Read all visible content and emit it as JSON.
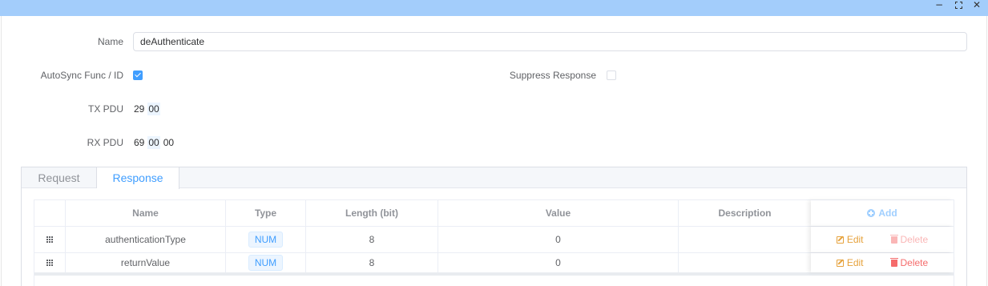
{
  "window": {
    "minimize": "−",
    "close": "✕",
    "maximize_icon": "maximize-icon"
  },
  "form": {
    "name_label": "Name",
    "name_value": "deAuthenticate",
    "autosync_label": "AutoSync Func / ID",
    "autosync_checked": true,
    "suppress_label": "Suppress Response",
    "suppress_checked": false,
    "tx_label": "TX PDU",
    "tx_bytes": [
      "29",
      "00"
    ],
    "rx_label": "RX PDU",
    "rx_bytes": [
      "69",
      "00",
      "00"
    ]
  },
  "tabs": [
    {
      "label": "Request",
      "active": false
    },
    {
      "label": "Response",
      "active": true
    }
  ],
  "table": {
    "columns": [
      "Name",
      "Type",
      "Length (bit)",
      "Value",
      "Description"
    ],
    "add_label": "Add",
    "rows": [
      {
        "name": "authenticationType",
        "type": "NUM",
        "length": "8",
        "value": "0",
        "description": "",
        "edit": "Edit",
        "delete": "Delete",
        "delete_disabled": true
      },
      {
        "name": "returnValue",
        "type": "NUM",
        "length": "8",
        "value": "0",
        "description": "",
        "edit": "Edit",
        "delete": "Delete",
        "delete_disabled": false
      }
    ]
  },
  "colors": {
    "accent": "#409eff",
    "titlebar": "#a3cdfb",
    "edit": "#e6a23c",
    "delete": "#f56c6c"
  }
}
